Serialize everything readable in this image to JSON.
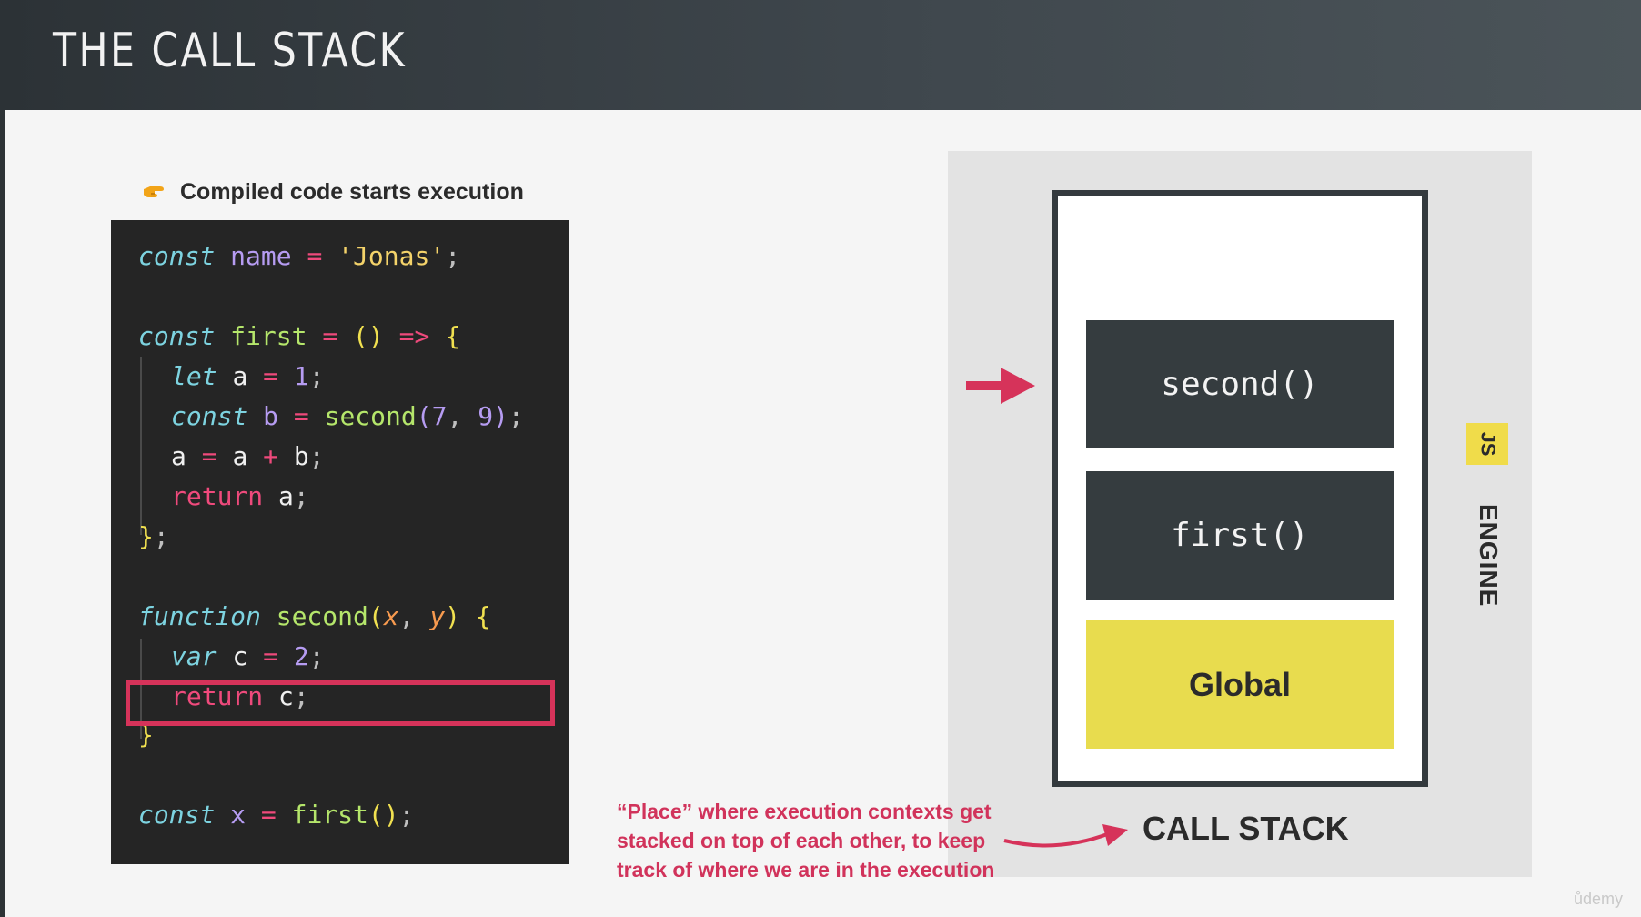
{
  "header": {
    "title": "THE CALL STACK"
  },
  "bullet": {
    "icon": "pointing-hand-icon",
    "text": "Compiled code starts execution"
  },
  "code": {
    "l1": {
      "kw": "const",
      "name": "name",
      "eq": "=",
      "str": "'Jonas'",
      "semi": ";"
    },
    "l2": {
      "kw": "const",
      "name": "first",
      "eq": "=",
      "parens": "()",
      "arrow": "=>",
      "brace": "{"
    },
    "l3": {
      "kw": "let",
      "name": "a",
      "eq": "=",
      "num": "1",
      "semi": ";"
    },
    "l4": {
      "kw": "const",
      "name": "b",
      "eq": "=",
      "fn": "second",
      "open": "(",
      "n1": "7",
      "comma": ",",
      "n2": "9",
      "close": ")",
      "semi": ";"
    },
    "l5": {
      "a1": "a",
      "eq": "=",
      "a2": "a",
      "plus": "+",
      "b": "b",
      "semi": ";"
    },
    "l6": {
      "kw": "return",
      "a": "a",
      "semi": ";"
    },
    "l7": {
      "brace": "}",
      "semi": ";"
    },
    "l8": {
      "kw": "function",
      "fn": "second",
      "open": "(",
      "x": "x",
      "comma": ",",
      "y": "y",
      "close": ")",
      "brace": "{"
    },
    "l9": {
      "kw": "var",
      "c": "c",
      "eq": "=",
      "num": "2",
      "semi": ";"
    },
    "l10": {
      "kw": "return",
      "c": "c",
      "semi": ";"
    },
    "l11": {
      "brace": "}"
    },
    "l12": {
      "kw": "const",
      "x": "x",
      "eq": "=",
      "fn": "first",
      "parens": "()",
      "semi": ";"
    }
  },
  "engine": {
    "badge": "JS",
    "label": "ENGINE",
    "stack_label": "CALL STACK",
    "contexts": [
      "second()",
      "first()",
      "Global"
    ]
  },
  "note": {
    "lines": [
      "“Place” where execution contexts get",
      "stacked on top of each other, to keep",
      "track of where we are in the execution"
    ]
  },
  "watermark": "ůdemy",
  "colors": {
    "highlight": "#d6335a",
    "arrow": "#d6335a",
    "global": "#e8dc4e",
    "context": "#353c3f"
  }
}
